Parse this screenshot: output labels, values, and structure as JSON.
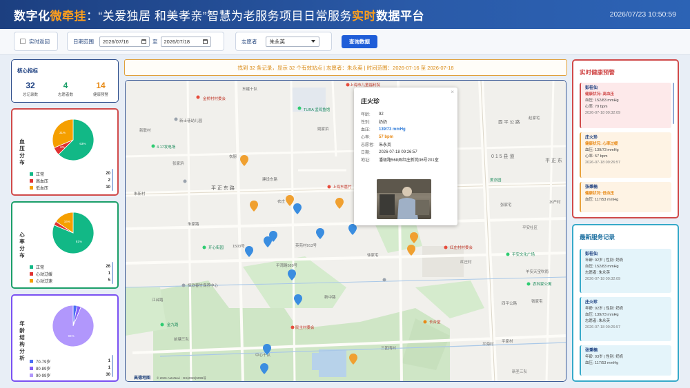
{
  "header": {
    "title_part1": "数字化",
    "title_part2": "微牵挂",
    "title_part3": "：“关爱独居 和美孝亲”智慧为老服务项目日常服务",
    "title_part4": "实时",
    "title_part5": "数据平台",
    "datetime": "2026/07/23 10:50:59"
  },
  "toolbar": {
    "realtime_label": "实时返回",
    "date_range_label": "日期范围",
    "start_date": "2026/07/16",
    "date_separator": "至",
    "end_date": "2026/07/18",
    "volunteer_label": "志愿者",
    "volunteer_selected": "朱永英",
    "query_label": "查询数据"
  },
  "metrics": {
    "title": "核心指标",
    "items": [
      {
        "value": "32",
        "label": "总记录数",
        "color": "#1c3f80"
      },
      {
        "value": "4",
        "label": "志愿者数",
        "color": "#1a9e68"
      },
      {
        "value": "14",
        "label": "健康预警",
        "color": "#e88a16"
      }
    ]
  },
  "charts": {
    "bp": {
      "title": "血压分布",
      "border": "#d04a4a",
      "chart_data": {
        "type": "pie",
        "categories": [
          "正常",
          "高血压",
          "低血压"
        ],
        "values": [
          20,
          2,
          10
        ],
        "slice_labels": [
          "63%",
          "6%",
          "31%"
        ],
        "colors": [
          "#12b886",
          "#e03131",
          "#f59f00"
        ]
      }
    },
    "hr": {
      "title": "心率分布",
      "border": "#1a9e68",
      "chart_data": {
        "type": "pie",
        "categories": [
          "正常",
          "心动过缓",
          "心动过速"
        ],
        "values": [
          26,
          1,
          5
        ],
        "slice_labels": [
          "81%",
          "",
          "16%"
        ],
        "colors": [
          "#12b886",
          "#e03131",
          "#f59f00"
        ]
      }
    },
    "age": {
      "title": "年龄结构分析",
      "border": "#7950f2",
      "chart_data": {
        "type": "pie",
        "categories": [
          "70-79岁",
          "80-89岁",
          "90-99岁"
        ],
        "values": [
          1,
          1,
          30
        ],
        "slice_labels": [
          "",
          "",
          "94%"
        ],
        "colors": [
          "#4c6ef5",
          "#845ef7",
          "#b197fc"
        ]
      }
    }
  },
  "banner": {
    "text": "找到 32 条记录，显示 32 个有效站点 | 志愿者：朱永英 | 时间范围：2026-07-16 至 2026-07-18"
  },
  "map": {
    "labels": [
      "东建十队",
      "金桥村村委会",
      "新士巷幼儿园",
      "新联村",
      "TURA 孟鸡鱼馆",
      "姚家浜",
      "4.17发电场",
      "衣厨",
      "张家浜",
      "上海东嘉竹",
      "平 正 东 路",
      "衣庄",
      "建设东路",
      "朱新村",
      "朱家路",
      "1503号",
      "开心街园",
      "英苑村913号",
      "平湾路589号",
      "恒欣春竹保养中心",
      "江台路",
      "新中路",
      "西 平 公 路",
      "赵家宅",
      "0 1 5 县 道",
      "平 正 东",
      "爱亦园",
      "张家宅",
      "水产村",
      "平安社区",
      "红庄村村委会",
      "红庄村",
      "平安文化广场",
      "羊安天宝吹雨",
      "徐家宅",
      "四平公路",
      "农科家公寓",
      "钱家宅",
      "平家村",
      "新圣三队",
      "前塘三队",
      "中心十队",
      "民主村委会",
      "三团湾村",
      "长合堂",
      "平海村",
      "上海市儿童福利院",
      "金九路",
      "高德地图",
      "© 2026 AutoNavi - GS(2025)5996号"
    ]
  },
  "popup": {
    "name": "庄火珍",
    "fields": [
      {
        "k": "年龄:",
        "v": "92"
      },
      {
        "k": "性别:",
        "v": "奶奶"
      },
      {
        "k": "血压:",
        "v": "139/73 mmHg"
      },
      {
        "k": "心率:",
        "v": "57 bpm"
      },
      {
        "k": "志愿者:",
        "v": "朱永英"
      },
      {
        "k": "日期:",
        "v": "2026-07-18 09:26:57"
      },
      {
        "k": "地址:",
        "v": "潘极路568弄红庄新苑36号201室"
      }
    ],
    "close": "×"
  },
  "alerts": {
    "title": "实时健康预警",
    "items": [
      {
        "name": "彭桂仙",
        "status": "健康状况: 高血压",
        "bp": "血压: 152/83 mmHg",
        "hr": "心率: 79 bpm",
        "time": "2026-07-18 09:32:09"
      },
      {
        "name": "庄火珍",
        "status": "健康状况: 心率过缓",
        "bp": "血压: 139/73 mmHg",
        "hr": "心率: 57 bpm",
        "time": "2026-07-18 09:26:57"
      },
      {
        "name": "张秉楠",
        "status": "健康状况: 低血压",
        "bp": "血压: 117/53 mmHg",
        "hr": "",
        "time": ""
      }
    ]
  },
  "records": {
    "title": "最新服务记录",
    "items": [
      {
        "name": "彭桂仙",
        "info": "年龄: 92岁 | 性别: 奶奶",
        "bp": "血压: 152/83 mmHg",
        "vol": "志愿者: 朱永英",
        "time": "2026-07-18 09:32:09"
      },
      {
        "name": "庄火珍",
        "info": "年龄: 92岁 | 性别: 奶奶",
        "bp": "血压: 139/73 mmHg",
        "vol": "志愿者: 朱永英",
        "time": "2026-07-18 09:26:57"
      },
      {
        "name": "张秉楠",
        "info": "年龄: 93岁 | 性别: 奶奶",
        "bp": "血压: 117/53 mmHg",
        "vol": "",
        "time": ""
      }
    ]
  }
}
